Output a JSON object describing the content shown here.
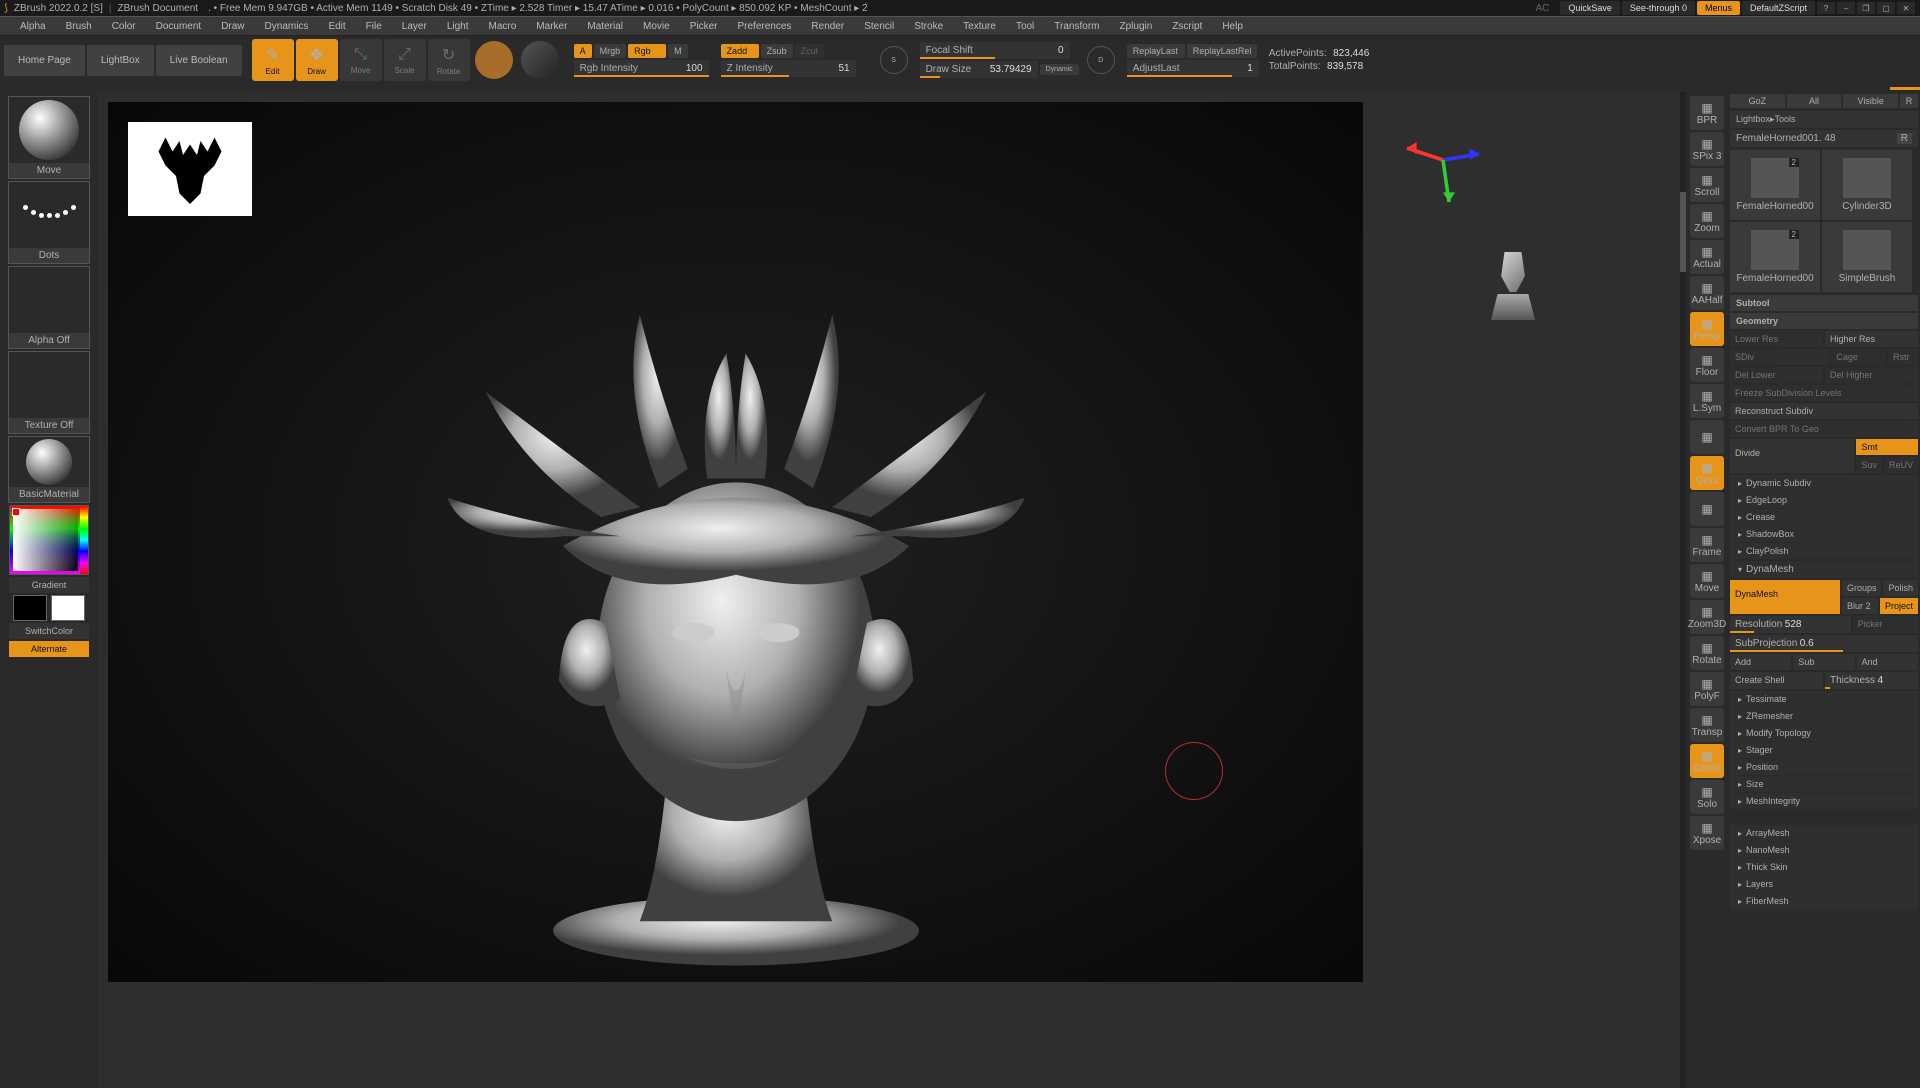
{
  "titlebar": {
    "app": "ZBrush 2022.0.2 [S]",
    "doc": "ZBrush Document",
    "stats": ".  • Free Mem 9.947GB • Active Mem 1149 • Scratch Disk 49 •  ZTime ▸ 2.528 Timer ▸ 15.47 ATime ▸ 0.016  • PolyCount ▸ 850.092 KP  • MeshCount ▸ 2",
    "ac": "AC",
    "quicksave": "QuickSave",
    "seethrough": "See-through  0",
    "menus": "Menus",
    "defaultscript": "DefaultZScript"
  },
  "menu": [
    "Alpha",
    "Brush",
    "Color",
    "Document",
    "Draw",
    "Dynamics",
    "Edit",
    "File",
    "Layer",
    "Light",
    "Macro",
    "Marker",
    "Material",
    "Movie",
    "Picker",
    "Preferences",
    "Render",
    "Stencil",
    "Stroke",
    "Texture",
    "Tool",
    "Transform",
    "Zplugin",
    "Zscript",
    "Help"
  ],
  "toolbar": {
    "tabs": [
      "Home Page",
      "LightBox",
      "Live Boolean"
    ],
    "modes": [
      {
        "l": "Edit",
        "on": true
      },
      {
        "l": "Draw",
        "on": true
      },
      {
        "l": "Move",
        "on": false
      },
      {
        "l": "Scale",
        "on": false
      },
      {
        "l": "Rotate",
        "on": false
      }
    ],
    "chips1": {
      "A": "A",
      "Mrgb": "Mrgb",
      "Rgb": "Rgb",
      "M": "M"
    },
    "chips2": {
      "Zadd": "Zadd",
      "Zsub": "Zsub",
      "Zcut": "Zcut"
    },
    "rgb_int": {
      "l": "Rgb Intensity",
      "v": "100"
    },
    "z_int": {
      "l": "Z Intensity",
      "v": "51"
    },
    "focal": {
      "l": "Focal Shift",
      "v": "0"
    },
    "drawsize": {
      "l": "Draw Size",
      "v": "53.79429"
    },
    "dynamic": "Dynamic",
    "replay": "ReplayLast",
    "replayrel": "ReplayLastRel",
    "adjust": {
      "l": "AdjustLast",
      "v": "1"
    },
    "active": {
      "l": "ActivePoints:",
      "v": "823,446"
    },
    "total": {
      "l": "TotalPoints:",
      "v": "839,578"
    }
  },
  "left": {
    "brush": "Move",
    "stroke": "Dots",
    "alpha": "Alpha Off",
    "tex": "Texture Off",
    "mat": "BasicMaterial",
    "grad": "Gradient",
    "switch": "SwitchColor",
    "alt": "Alternate"
  },
  "vtool": [
    {
      "l": "BPR"
    },
    {
      "l": "SPix 3"
    },
    {
      "l": "Scroll"
    },
    {
      "l": "Zoom"
    },
    {
      "l": "Actual"
    },
    {
      "l": "AAHalf"
    },
    {
      "l": "Persp",
      "on": true
    },
    {
      "l": "Floor"
    },
    {
      "l": "L.Sym"
    },
    {
      "l": ""
    },
    {
      "l": "Qxyz",
      "on": true
    },
    {
      "l": ""
    },
    {
      "l": "Frame"
    },
    {
      "l": "Move"
    },
    {
      "l": "Zoom3D"
    },
    {
      "l": "Rotate"
    },
    {
      "l": "PolyF"
    },
    {
      "l": "Transp"
    },
    {
      "l": "Ghost",
      "on": true
    },
    {
      "l": "Solo"
    },
    {
      "l": "Xpose"
    }
  ],
  "right": {
    "top": [
      "GoZ",
      "All",
      "Visible",
      "R"
    ],
    "lightbox": "Lightbox▸Tools",
    "tool_name": "FemaleHorned001.  48",
    "tool_r": "R",
    "tools": [
      {
        "n": "FemaleHorned00",
        "b": "2"
      },
      {
        "n": "Cylinder3D"
      },
      {
        "n": "FemaleHorned00",
        "b": "2"
      },
      {
        "n": "SimpleBrush"
      }
    ],
    "subtool": "Subtool",
    "geometry": "Geometry",
    "geo": {
      "lower": "Lower Res",
      "higher": "Higher Res",
      "sdiv": "SDiv",
      "cage": "Cage",
      "rstr": "Rstr",
      "dellower": "Del Lower",
      "delhigher": "Del Higher",
      "freeze": "Freeze SubDivision Levels",
      "recon": "Reconstruct Subdiv",
      "convert": "Convert BPR To Geo",
      "divide": "Divide",
      "smt": "Smt",
      "suv": "Suv",
      "reuv": "ReUV"
    },
    "headers": [
      "Dynamic Subdiv",
      "EdgeLoop",
      "Crease",
      "ShadowBox",
      "ClayPolish"
    ],
    "dyna_h": "DynaMesh",
    "dyna": {
      "dynamesh": "DynaMesh",
      "groups": "Groups",
      "polish": "Polish",
      "blur": "Blur  2",
      "project": "Project",
      "res": "Resolution",
      "res_v": "528",
      "picker": "Picker",
      "subproj": "SubProjection",
      "subproj_v": "0.6",
      "add": "Add",
      "sub": "Sub",
      "and": "And",
      "shell": "Create Shell",
      "thick": "Thickness",
      "thick_v": "4"
    },
    "headers2": [
      "Tessimate",
      "ZRemesher",
      "Modify Topology",
      "Stager",
      "Position",
      "Size",
      "MeshIntegrity"
    ],
    "headers3": [
      "ArrayMesh",
      "NanoMesh",
      "Thick Skin",
      "Layers",
      "FiberMesh"
    ]
  }
}
